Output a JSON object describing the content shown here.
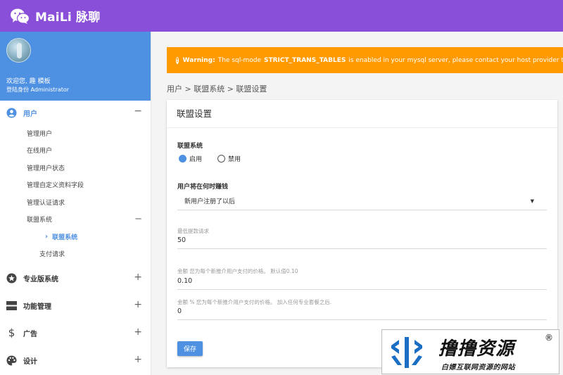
{
  "app": {
    "title": "MaiLi 脉聊"
  },
  "profile": {
    "welcome": "欢迎您, 趣 模板",
    "role": "登陆身份 Administrator"
  },
  "sidebar": {
    "user_section": {
      "label": "用户",
      "toggle": "−"
    },
    "user_items": [
      {
        "label": "管理用户"
      },
      {
        "label": "在线用户"
      },
      {
        "label": "管理用户状态"
      },
      {
        "label": "管理自定义资料字段"
      },
      {
        "label": "管理认证请求"
      }
    ],
    "affiliate": {
      "label": "联盟系统",
      "toggle": "−"
    },
    "affiliate_sub": {
      "label": "联盟系统",
      "chev": "›"
    },
    "payment": {
      "label": "支付请求"
    },
    "sections": [
      {
        "label": "专业版系统",
        "toggle": "+"
      },
      {
        "label": "功能管理",
        "toggle": "+"
      },
      {
        "label": "广告",
        "toggle": "+"
      },
      {
        "label": "设计",
        "toggle": "+"
      }
    ]
  },
  "warning": {
    "prefix": "Warning:",
    "text_before": "The sql-mode",
    "code": "STRICT_TRANS_TABLES",
    "text_after": "is enabled in your mysql server, please contact your host provider to d"
  },
  "breadcrumb": "用户 > 联盟系统 > 联盟设置",
  "form": {
    "title": "联盟设置",
    "system_label": "联盟系统",
    "radio_on": "启用",
    "radio_off": "禁用",
    "earn_label": "用户将在何时赚钱",
    "earn_value": "新用户注册了以后",
    "min_hint": "最低提款请求",
    "min_value": "50",
    "amount_hint": "金额 您为每个新推介用户支付的价格。 默认值0.10",
    "amount_value": "0.10",
    "percent_hint": "金额 % 您为每个新推介用户支付的价格。 加入任何专业套餐之后.",
    "percent_value": "0",
    "save_label": "保存"
  },
  "watermark": {
    "main": "撸撸资源",
    "reg": "®",
    "sub": "白嫖互联网资源的网站"
  },
  "colors": {
    "topbar": "#8a4fd9",
    "accent": "#4e90e2",
    "warning": "#ff9a00"
  }
}
